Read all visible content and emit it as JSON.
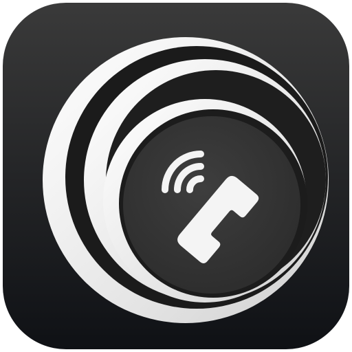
{
  "icon": {
    "name": "phone-call-app-icon",
    "depicts": [
      "rounded-square-tile",
      "concentric-crescent-rings",
      "phone-handset",
      "signal-waves"
    ],
    "colors": {
      "tile_top": "#3a3a3a",
      "tile_bottom": "#0f1115",
      "ring_light": "#ececec",
      "ring_dark": "#1c1c1c",
      "center_disc": "#373737",
      "glyph": "#f4f4f4"
    }
  }
}
